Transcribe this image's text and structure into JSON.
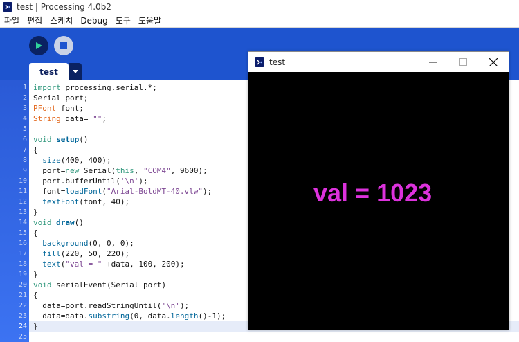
{
  "window": {
    "title": "test | Processing 4.0b2"
  },
  "menu": [
    "파일",
    "편집",
    "스케치",
    "Debug",
    "도구",
    "도움말"
  ],
  "toolbar": {
    "run_icon": "play-icon",
    "stop_icon": "stop-icon",
    "tab_label": "test",
    "tab_menu_icon": "chevron-down-icon"
  },
  "colors": {
    "toolbar_blue": "#1e54cf",
    "sketch_text": "#dc32dc",
    "run_green": "#2fd19a"
  },
  "editor": {
    "current_line": 24,
    "line_numbers": [
      "1",
      "2",
      "3",
      "4",
      "5",
      "6",
      "7",
      "8",
      "9",
      "10",
      "11",
      "12",
      "13",
      "14",
      "15",
      "16",
      "17",
      "18",
      "19",
      "20",
      "21",
      "22",
      "23",
      "24",
      "25"
    ],
    "lines": [
      "import processing.serial.*;",
      "Serial port;",
      "PFont font;",
      "String data= \"\";",
      "",
      "void setup()",
      "{",
      "  size(400, 400);",
      "  port=new Serial(this, \"COM4\", 9600);",
      "  port.bufferUntil('\\n');",
      "  font=loadFont(\"Arial-BoldMT-40.vlw\");",
      "  textFont(font, 40);",
      "}",
      "void draw()",
      "{",
      "  background(0, 0, 0);",
      "  fill(220, 50, 220);",
      "  text(\"val = \" +data, 100, 200);",
      "}",
      "void serialEvent(Serial port)",
      "{",
      "  data=port.readStringUntil('\\n');",
      "  data=data.substring(0, data.length()-1);",
      "}",
      ""
    ]
  },
  "sketch": {
    "title": "test",
    "output": "val = 1023"
  }
}
